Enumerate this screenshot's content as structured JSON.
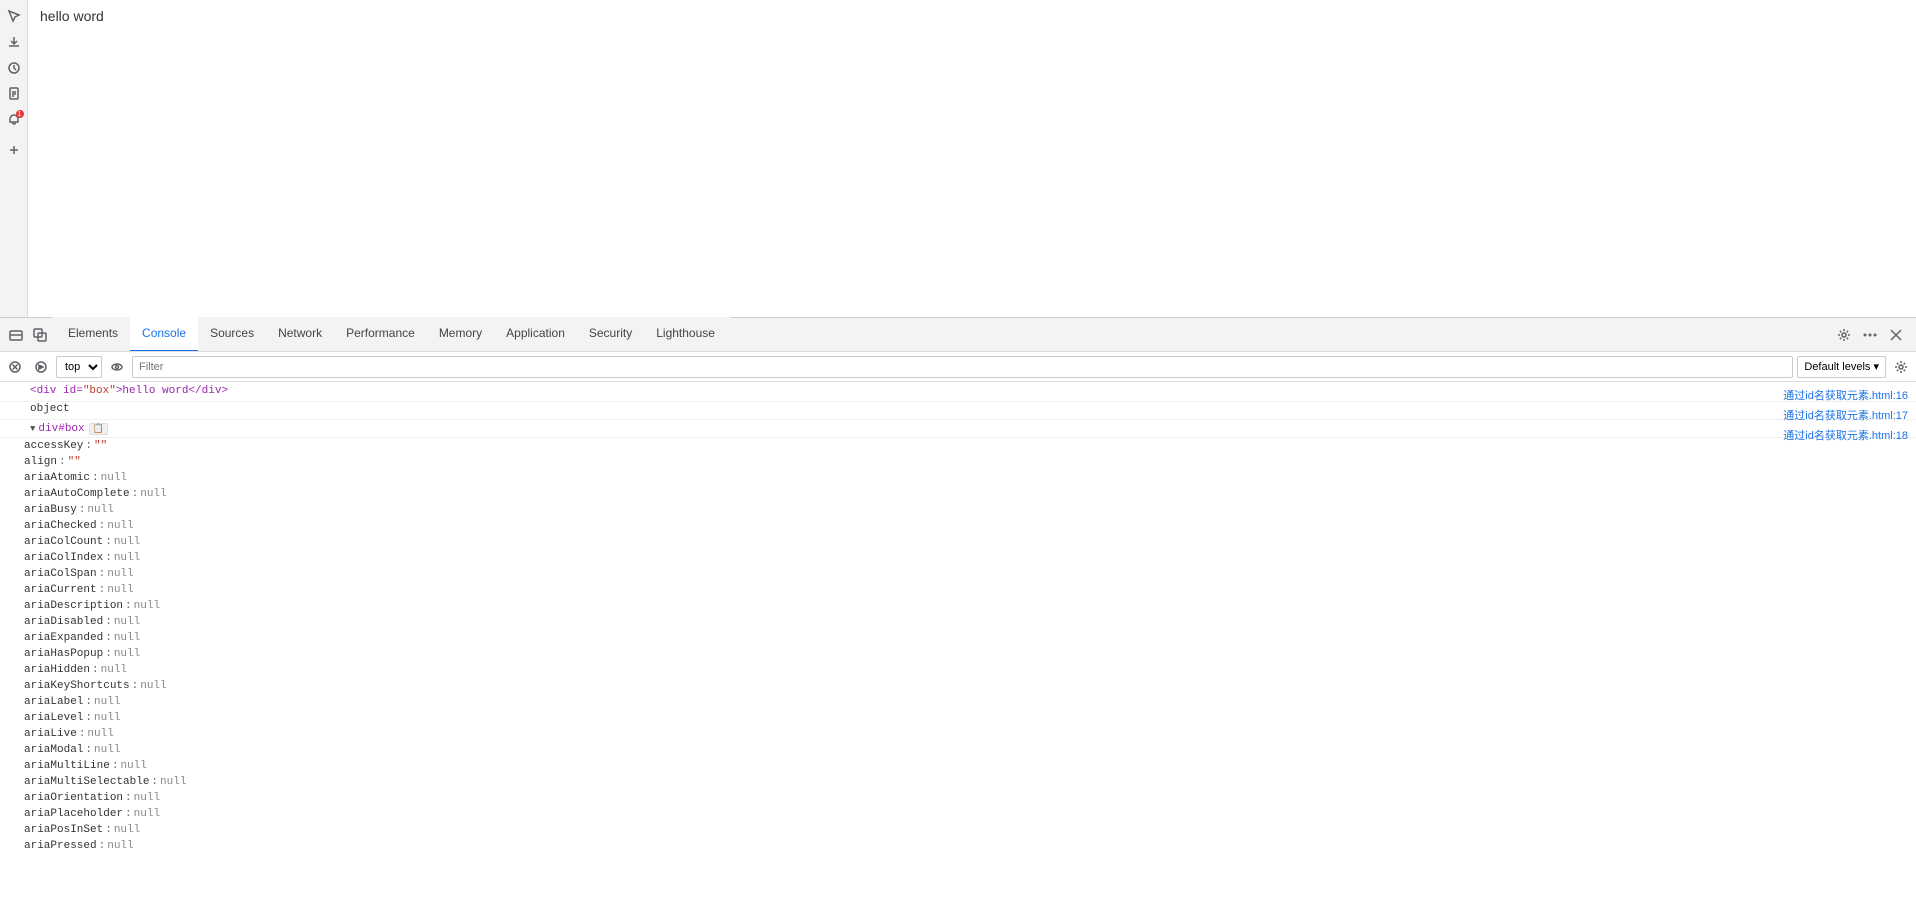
{
  "page": {
    "title": "hello word"
  },
  "devtools": {
    "tabs": [
      {
        "id": "elements",
        "label": "Elements",
        "active": false
      },
      {
        "id": "console",
        "label": "Console",
        "active": true
      },
      {
        "id": "sources",
        "label": "Sources",
        "active": false
      },
      {
        "id": "network",
        "label": "Network",
        "active": false
      },
      {
        "id": "performance",
        "label": "Performance",
        "active": false
      },
      {
        "id": "memory",
        "label": "Memory",
        "active": false
      },
      {
        "id": "application",
        "label": "Application",
        "active": false
      },
      {
        "id": "security",
        "label": "Security",
        "active": false
      },
      {
        "id": "lighthouse",
        "label": "Lighthouse",
        "active": false
      }
    ],
    "console": {
      "context_selector": "top",
      "filter_placeholder": "Filter",
      "default_levels_label": "Default levels ▾",
      "html_tag_line": "<div id=\"box\">hello word</div>",
      "object_label": "object",
      "div_node_label": "▼ div#box",
      "div_badge": "📋",
      "properties": [
        {
          "name": "accessKey",
          "value": "\"\"",
          "type": "string"
        },
        {
          "name": "align",
          "value": "\"\"",
          "type": "string"
        },
        {
          "name": "ariaAtomic",
          "value": "null",
          "type": "null"
        },
        {
          "name": "ariaAutoComplete",
          "value": "null",
          "type": "null"
        },
        {
          "name": "ariaBusy",
          "value": "null",
          "type": "null"
        },
        {
          "name": "ariaChecked",
          "value": "null",
          "type": "null"
        },
        {
          "name": "ariaColCount",
          "value": "null",
          "type": "null"
        },
        {
          "name": "ariaColIndex",
          "value": "null",
          "type": "null"
        },
        {
          "name": "ariaColSpan",
          "value": "null",
          "type": "null"
        },
        {
          "name": "ariaCurrent",
          "value": "null",
          "type": "null"
        },
        {
          "name": "ariaDescription",
          "value": "null",
          "type": "null"
        },
        {
          "name": "ariaDisabled",
          "value": "null",
          "type": "null"
        },
        {
          "name": "ariaExpanded",
          "value": "null",
          "type": "null"
        },
        {
          "name": "ariaHasPopup",
          "value": "null",
          "type": "null"
        },
        {
          "name": "ariaHidden",
          "value": "null",
          "type": "null"
        },
        {
          "name": "ariaKeyShortcuts",
          "value": "null",
          "type": "null"
        },
        {
          "name": "ariaLabel",
          "value": "null",
          "type": "null"
        },
        {
          "name": "ariaLevel",
          "value": "null",
          "type": "null"
        },
        {
          "name": "ariaLive",
          "value": "null",
          "type": "null"
        },
        {
          "name": "ariaModal",
          "value": "null",
          "type": "null"
        },
        {
          "name": "ariaMultiLine",
          "value": "null",
          "type": "null"
        },
        {
          "name": "ariaMultiSelectable",
          "value": "null",
          "type": "null"
        },
        {
          "name": "ariaOrientation",
          "value": "null",
          "type": "null"
        },
        {
          "name": "ariaPlaceholder",
          "value": "null",
          "type": "null"
        },
        {
          "name": "ariaPosInSet",
          "value": "null",
          "type": "null"
        },
        {
          "name": "ariaPressed",
          "value": "null",
          "type": "null"
        }
      ]
    }
  },
  "right_links": [
    {
      "label": "通过id名获取元素.html:16",
      "line": 16
    },
    {
      "label": "通过id名获取元素.html:17",
      "line": 17
    },
    {
      "label": "通过id名获取元素.html:18",
      "line": 18
    }
  ],
  "sidebar": {
    "icons": [
      {
        "name": "inspect",
        "symbol": "↗",
        "badge": false
      },
      {
        "name": "download",
        "symbol": "⬇",
        "badge": false
      },
      {
        "name": "clock",
        "symbol": "🕐",
        "badge": false
      },
      {
        "name": "document",
        "symbol": "📄",
        "badge": false
      },
      {
        "name": "notification",
        "symbol": "🔔",
        "badge": true,
        "badge_count": "1"
      },
      {
        "name": "add",
        "symbol": "+",
        "badge": false
      }
    ]
  }
}
